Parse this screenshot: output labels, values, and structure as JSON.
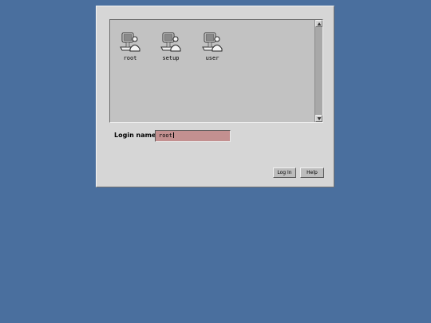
{
  "users": [
    {
      "name": "root",
      "icon": "user-workstation-icon"
    },
    {
      "name": "setup",
      "icon": "user-workstation-icon"
    },
    {
      "name": "user",
      "icon": "user-workstation-icon"
    }
  ],
  "login": {
    "label": "Login name:",
    "value": "root"
  },
  "buttons": {
    "login_label": "Log In",
    "help_label": "Help"
  },
  "colors": {
    "desktop": "#4a6f9e",
    "dialog": "#d6d6d6",
    "list_background": "#c2c2c2",
    "input_background": "#c39090"
  }
}
